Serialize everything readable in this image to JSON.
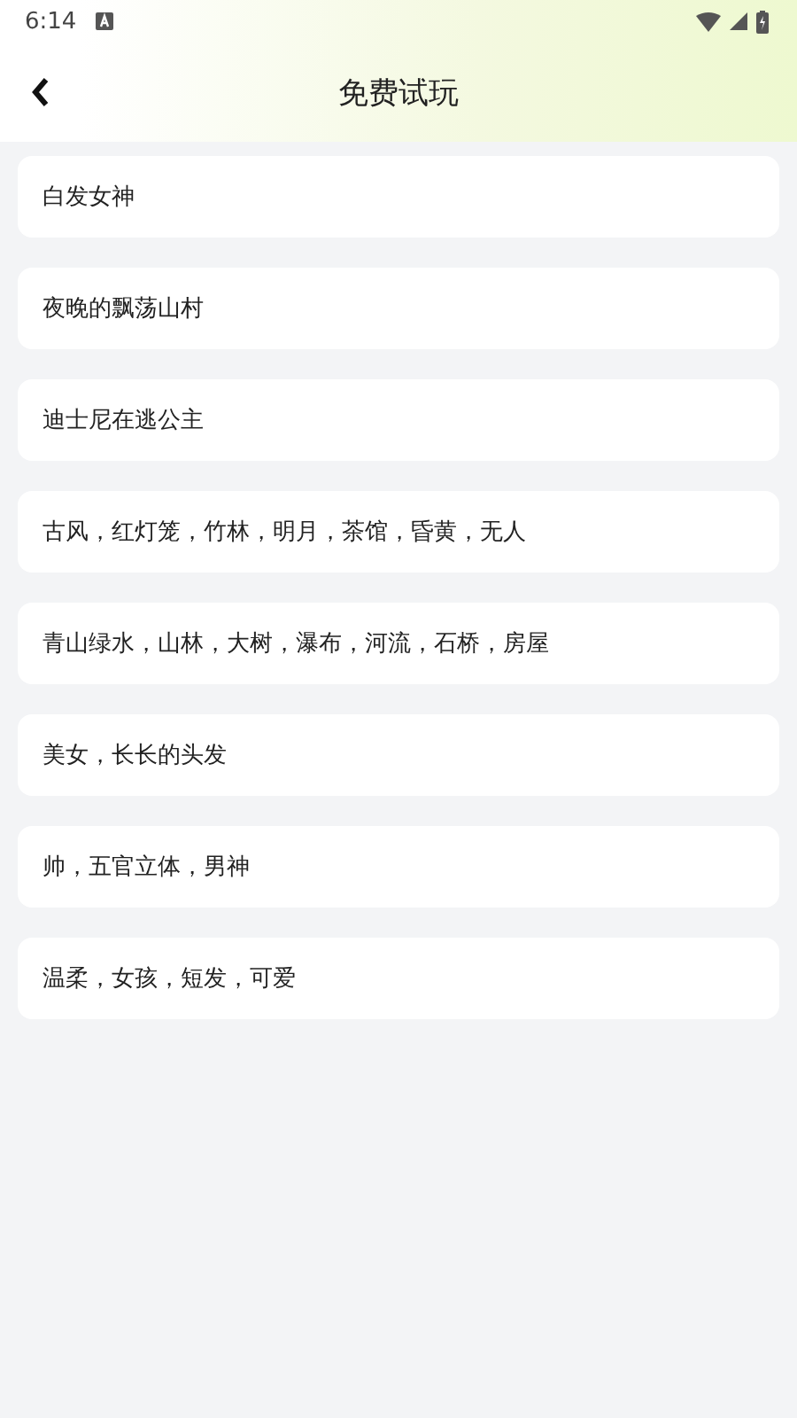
{
  "status_bar": {
    "time": "6:14"
  },
  "header": {
    "title": "免费试玩"
  },
  "items": [
    {
      "text": "白发女神"
    },
    {
      "text": "夜晚的飘荡山村"
    },
    {
      "text": "迪士尼在逃公主"
    },
    {
      "text": "古风，红灯笼，竹林，明月，茶馆，昏黄，无人"
    },
    {
      "text": "青山绿水，山林，大树，瀑布，河流，石桥，房屋"
    },
    {
      "text": "美女，长长的头发"
    },
    {
      "text": "帅，五官立体，男神"
    },
    {
      "text": "温柔，女孩，短发，可爱"
    }
  ]
}
